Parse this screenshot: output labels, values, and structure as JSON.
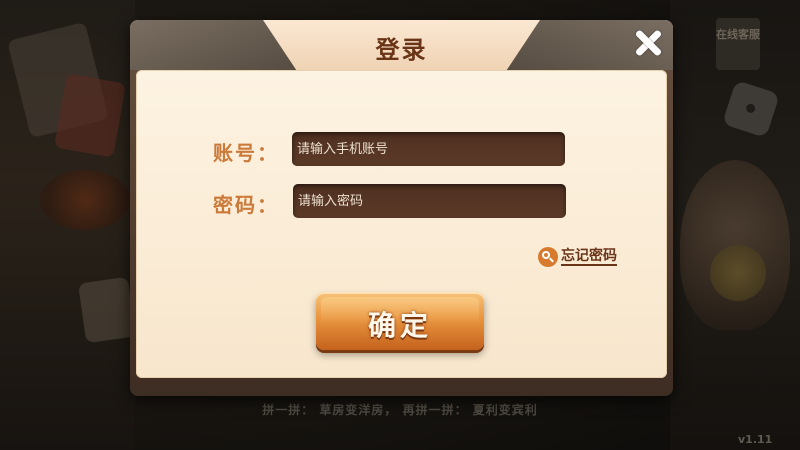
{
  "background": {
    "service_tag": "在线客服",
    "bottom_text": "拼一拼：  草房变洋房，  再拼一拼：  夏利变宾利",
    "version": "v1.11"
  },
  "dialog": {
    "title": "登录",
    "account_label": "账号：",
    "account_placeholder": "请输入手机账号",
    "account_value": "",
    "password_label": "密码：",
    "password_placeholder": "请输入密码",
    "password_value": "",
    "forgot_label": "忘记密码",
    "confirm_label": "确定"
  },
  "icons": {
    "close": "close-icon",
    "forgot": "magnifier-icon"
  },
  "colors": {
    "label": "#cc7a3a",
    "title": "#6a3416",
    "button": "#e9953f",
    "input_bg": "#4e2f20"
  }
}
